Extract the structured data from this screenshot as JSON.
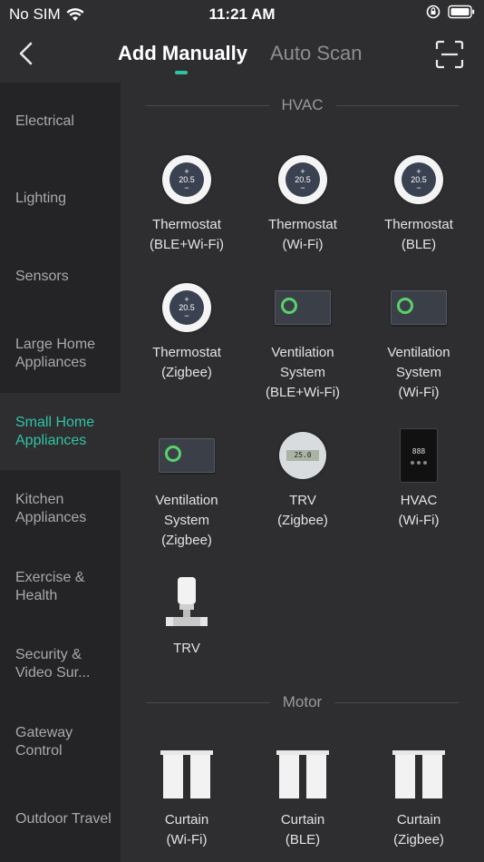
{
  "status_bar": {
    "carrier": "No SIM",
    "time": "11:21 AM"
  },
  "header": {
    "tab_active": "Add Manually",
    "tab_inactive": "Auto Scan"
  },
  "sidebar": {
    "items": [
      {
        "label": "Electrical",
        "selected": false
      },
      {
        "label": "Lighting",
        "selected": false
      },
      {
        "label": "Sensors",
        "selected": false
      },
      {
        "label": "Large Home Appliances",
        "selected": false
      },
      {
        "label": "Small Home Appliances",
        "selected": true
      },
      {
        "label": "Kitchen Appliances",
        "selected": false
      },
      {
        "label": "Exercise & Health",
        "selected": false
      },
      {
        "label": "Security & Video Sur...",
        "selected": false
      },
      {
        "label": "Gateway Control",
        "selected": false
      },
      {
        "label": "Outdoor Travel",
        "selected": false
      }
    ]
  },
  "sections": {
    "hvac": {
      "title": "HVAC",
      "devices": [
        {
          "line1": "Thermostat",
          "line2": "(BLE+Wi-Fi)",
          "line3": "",
          "icon": "thermostat-icon",
          "display": "20.5"
        },
        {
          "line1": "Thermostat",
          "line2": "(Wi-Fi)",
          "line3": "",
          "icon": "thermostat-icon",
          "display": "20.5"
        },
        {
          "line1": "Thermostat",
          "line2": "(BLE)",
          "line3": "",
          "icon": "thermostat-icon",
          "display": "20.5"
        },
        {
          "line1": "Thermostat",
          "line2": "(Zigbee)",
          "line3": "",
          "icon": "thermostat-icon",
          "display": "20.5"
        },
        {
          "line1": "Ventilation",
          "line2": "System",
          "line3": "(BLE+Wi-Fi)",
          "icon": "ventilation-icon"
        },
        {
          "line1": "Ventilation",
          "line2": "System",
          "line3": "(Wi-Fi)",
          "icon": "ventilation-icon"
        },
        {
          "line1": "Ventilation",
          "line2": "System",
          "line3": "(Zigbee)",
          "icon": "ventilation-icon"
        },
        {
          "line1": "TRV",
          "line2": "(Zigbee)",
          "line3": "",
          "icon": "trv-round-icon",
          "display": "25.0"
        },
        {
          "line1": "HVAC",
          "line2": "(Wi-Fi)",
          "line3": "",
          "icon": "hvac-panel-icon"
        },
        {
          "line1": "TRV",
          "line2": "",
          "line3": "",
          "icon": "trv-valve-icon"
        }
      ]
    },
    "motor": {
      "title": "Motor",
      "devices": [
        {
          "line1": "Curtain",
          "line2": "(Wi-Fi)",
          "icon": "curtain-icon"
        },
        {
          "line1": "Curtain",
          "line2": "(BLE)",
          "icon": "curtain-icon"
        },
        {
          "line1": "Curtain",
          "line2": "(Zigbee)",
          "icon": "curtain-icon"
        }
      ]
    }
  },
  "colors": {
    "accent": "#2ec4a3",
    "background": "#2e2e30",
    "sidebar": "#242426"
  }
}
